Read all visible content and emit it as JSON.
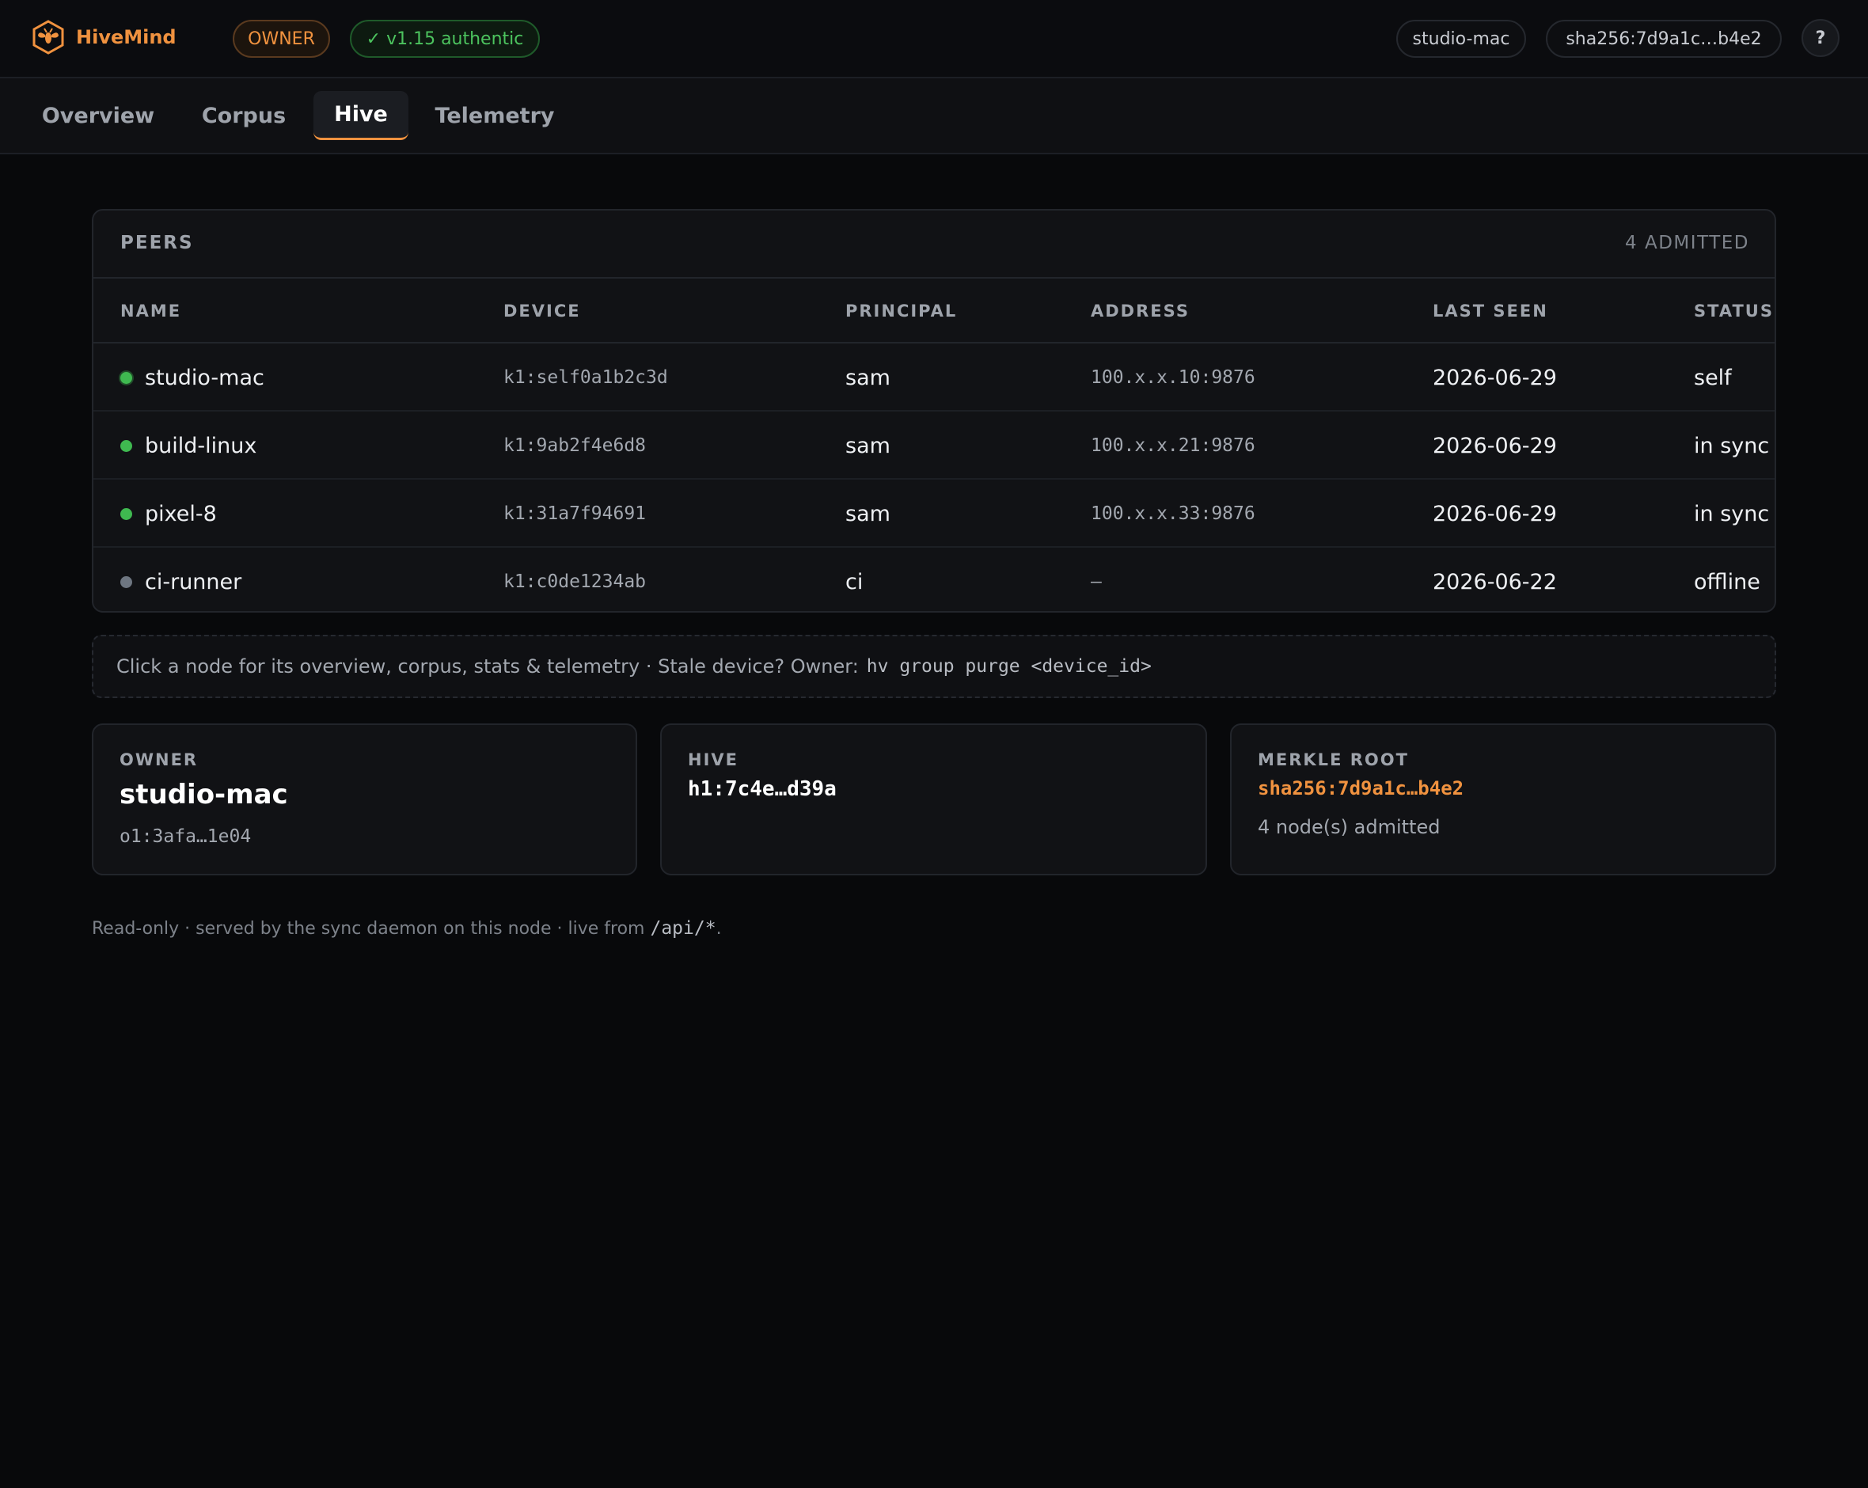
{
  "header": {
    "app_name": "HiveMind",
    "logo_icon": "hive-bee-icon",
    "role_badge": "OWNER",
    "version_badge": "✓ v1.15 authentic",
    "host": "studio-mac",
    "root_hash": "sha256:7d9a1c…b4e2",
    "help_label": "?",
    "brand_color": "#f0923f",
    "ok_color": "#4cc35e"
  },
  "tabs": [
    {
      "label": "Overview",
      "active": false
    },
    {
      "label": "Corpus",
      "active": false
    },
    {
      "label": "Hive",
      "active": true
    },
    {
      "label": "Telemetry",
      "active": false
    }
  ],
  "peers": {
    "title": "PEERS",
    "count_label": "4 ADMITTED",
    "columns": [
      "NAME",
      "DEVICE",
      "PRINCIPAL",
      "ADDRESS",
      "LAST SEEN",
      "STATUS"
    ],
    "rows": [
      {
        "name": "studio-mac",
        "device": "k1:self0a1b2c3d",
        "principal": "sam",
        "address": "100.x.x.10:9876",
        "last_seen": "2026-06-29",
        "status": "self",
        "online": true
      },
      {
        "name": "build-linux",
        "device": "k1:9ab2f4e6d8",
        "principal": "sam",
        "address": "100.x.x.21:9876",
        "last_seen": "2026-06-29",
        "status": "in sync",
        "online": true
      },
      {
        "name": "pixel-8",
        "device": "k1:31a7f94691",
        "principal": "sam",
        "address": "100.x.x.33:9876",
        "last_seen": "2026-06-29",
        "status": "in sync",
        "online": true
      },
      {
        "name": "ci-runner",
        "device": "k1:c0de1234ab",
        "principal": "ci",
        "address": "–",
        "last_seen": "2026-06-22",
        "status": "offline",
        "online": false
      }
    ],
    "online_color": "#3fb950",
    "offline_color": "#6e7681"
  },
  "hint": {
    "text": "Click a node for its overview, corpus, stats & telemetry · Stale device? Owner:",
    "command": "hv group purge <device_id>"
  },
  "cards": {
    "owner": {
      "label": "OWNER",
      "value": "studio-mac",
      "sub": "o1:3afa…1e04"
    },
    "hive": {
      "label": "HIVE",
      "value": "h1:7c4e…d39a"
    },
    "merkle": {
      "label": "MERKLE ROOT",
      "value": "sha256:7d9a1c…b4e2",
      "sub": "4 node(s) admitted"
    }
  },
  "footer": {
    "text": "Read-only · served by the sync daemon on this node · live from",
    "path": "/api/*",
    "suffix": "."
  }
}
